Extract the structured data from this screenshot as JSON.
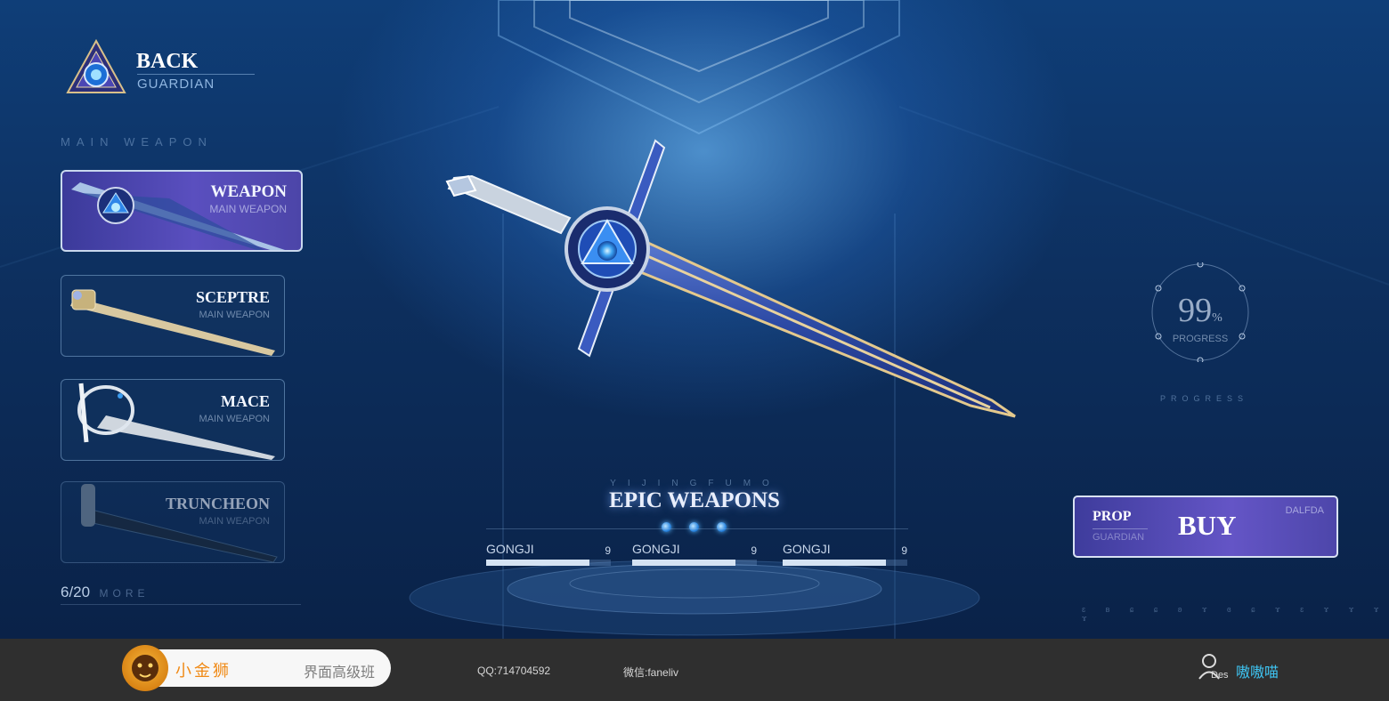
{
  "back": {
    "title": "BACK",
    "subtitle": "GUARDIAN"
  },
  "section_label": "MAIN WEAPON",
  "weapons": [
    {
      "name": "WEAPON",
      "sub": "MAIN WEAPON",
      "selected": true
    },
    {
      "name": "SCEPTRE",
      "sub": "MAIN WEAPON",
      "selected": false
    },
    {
      "name": "MACE",
      "sub": "MAIN WEAPON",
      "selected": false
    },
    {
      "name": "TRUNCHEON",
      "sub": "MAIN WEAPON",
      "selected": false
    }
  ],
  "pager": {
    "count": "6/20",
    "more": "MORE"
  },
  "feature": {
    "subtitle": "YIJINGFUMO",
    "title": "EPIC WEAPONS",
    "stats": [
      {
        "label": "GONGJI",
        "value": "9",
        "fill": 0.83
      },
      {
        "label": "GONGJI",
        "value": "9",
        "fill": 0.83
      },
      {
        "label": "GONGJI",
        "value": "9",
        "fill": 0.83
      }
    ]
  },
  "progress": {
    "value": "99",
    "unit": "%",
    "label": "PROGRESS",
    "caption": "PROGRESS"
  },
  "buy": {
    "prop": "PROP",
    "guardian": "GUARDIAN",
    "button": "BUY",
    "code": "DALFDA"
  },
  "runes": "ɛ ʙ ɕ ɕ ʚ ɤ ɞ ɕ ɤ ɛ ɤ ɤ ɤ ɤ",
  "footer": {
    "brand": "小金狮",
    "course": "界面高级班",
    "qq": "QQ:714704592",
    "wechat": "微信:faneliv",
    "user_tag": "Des",
    "user_name": "嗷嗷喵"
  },
  "colors": {
    "accent_purple": "#5a4fbf",
    "user_name": "#3ec4f2",
    "brand_orange": "#f08a16"
  }
}
